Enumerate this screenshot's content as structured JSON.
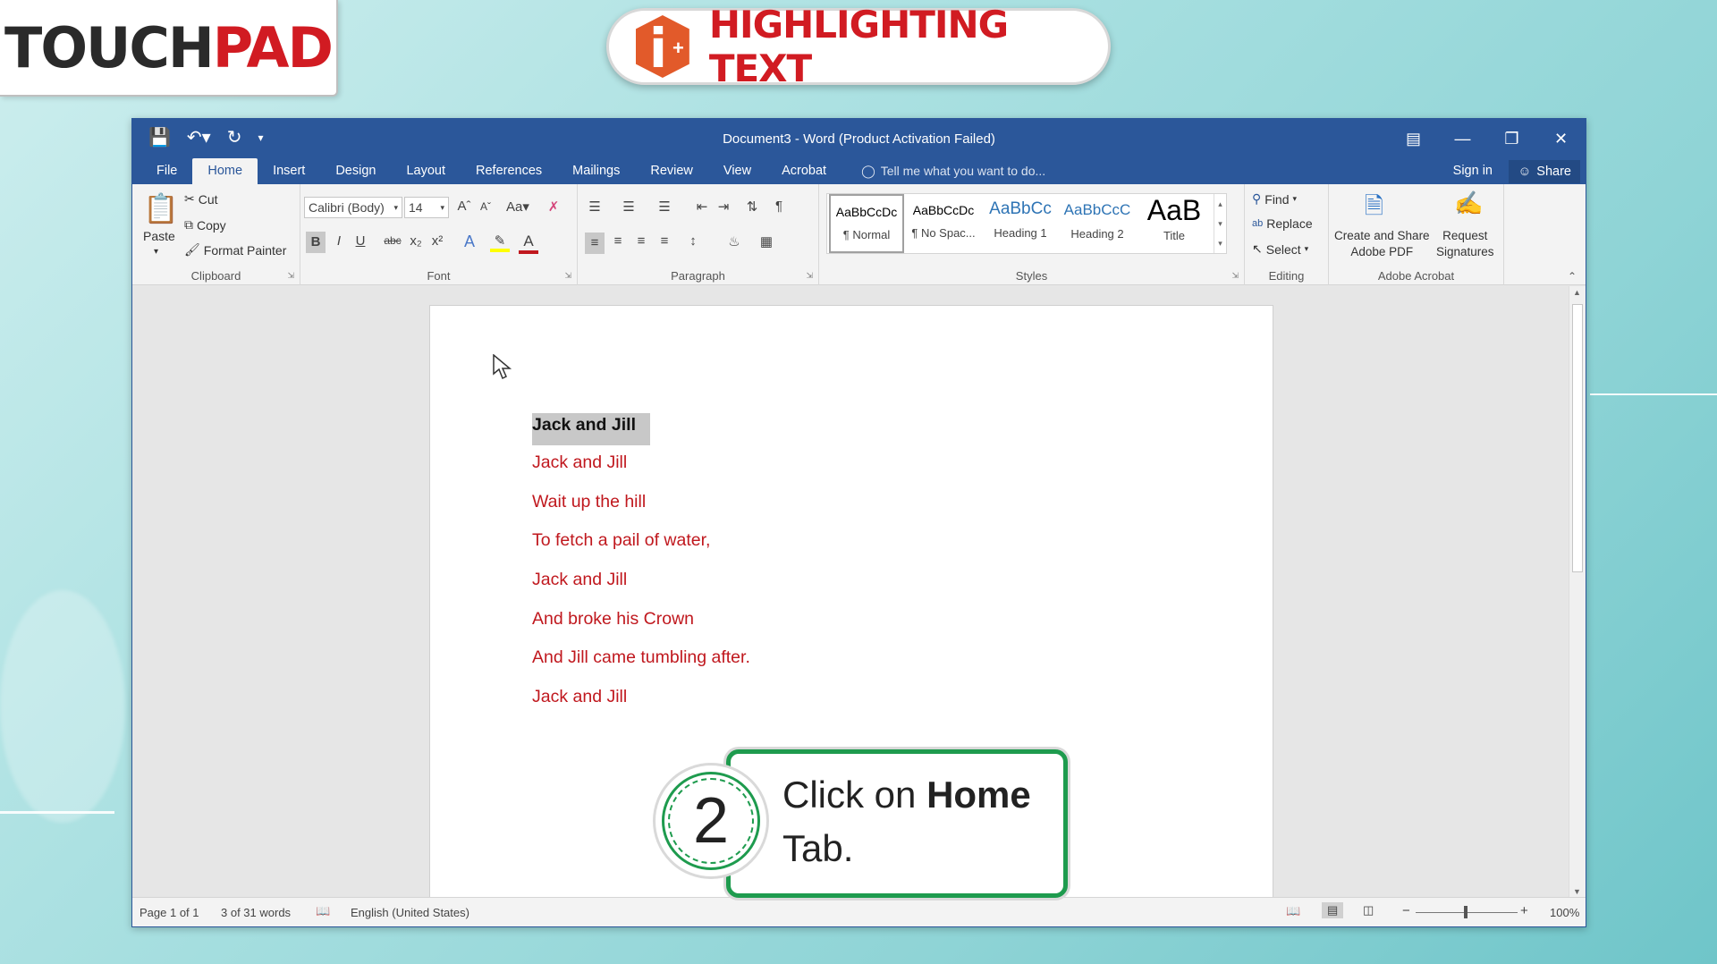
{
  "brand": {
    "logo_left": "TOUCH",
    "logo_right": "PAD",
    "title": "HIGHLIGHTING TEXT",
    "title_icon": "info-plus-icon"
  },
  "window": {
    "title": "Document3 - Word (Product Activation Failed)",
    "tabs": [
      "File",
      "Home",
      "Insert",
      "Design",
      "Layout",
      "References",
      "Mailings",
      "Review",
      "View",
      "Acrobat"
    ],
    "active_tab": "Home",
    "tell_me": "Tell me what you want to do...",
    "sign_in": "Sign in",
    "share": "Share"
  },
  "ribbon": {
    "clipboard": {
      "label": "Clipboard",
      "paste": "Paste",
      "cut": "Cut",
      "copy": "Copy",
      "format_painter": "Format Painter"
    },
    "font": {
      "label": "Font",
      "font_name": "Calibri (Body)",
      "font_size": "14",
      "case": "Aa",
      "bold": "B",
      "italic": "I",
      "underline": "U",
      "strike": "abc",
      "subscript": "x₂",
      "superscript": "x²"
    },
    "paragraph": {
      "label": "Paragraph"
    },
    "styles": {
      "label": "Styles",
      "items": [
        {
          "preview": "AaBbCcDc",
          "name": "¶ Normal"
        },
        {
          "preview": "AaBbCcDc",
          "name": "¶ No Spac..."
        },
        {
          "preview": "AaBbCc",
          "name": "Heading 1"
        },
        {
          "preview": "AaBbCcC",
          "name": "Heading 2"
        },
        {
          "preview": "AaB",
          "name": "Title"
        }
      ]
    },
    "editing": {
      "label": "Editing",
      "find": "Find",
      "replace": "Replace",
      "select": "Select"
    },
    "acrobat": {
      "label": "Adobe Acrobat",
      "create_l1": "Create and Share",
      "create_l2": "Adobe PDF",
      "request_l1": "Request",
      "request_l2": "Signatures"
    }
  },
  "document": {
    "lines": [
      "Jack and Jill",
      "Jack and Jill",
      "Wait up the hill",
      "To fetch a pail of water,",
      "Jack and Jill",
      "And broke his Crown",
      "And Jill came tumbling after.",
      "Jack and Jill"
    ],
    "selected_line_index": 0,
    "text_color": "#c0181e"
  },
  "status": {
    "page": "Page 1 of 1",
    "words": "3 of 31 words",
    "language": "English (United States)",
    "zoom": "100%"
  },
  "callout": {
    "step": "2",
    "text_pre": "Click on ",
    "text_bold": "Home",
    "text_post": "Tab.",
    "accent": "#1e9b4e"
  },
  "colors": {
    "word_blue": "#2b579a",
    "brand_red": "#d11b22"
  }
}
